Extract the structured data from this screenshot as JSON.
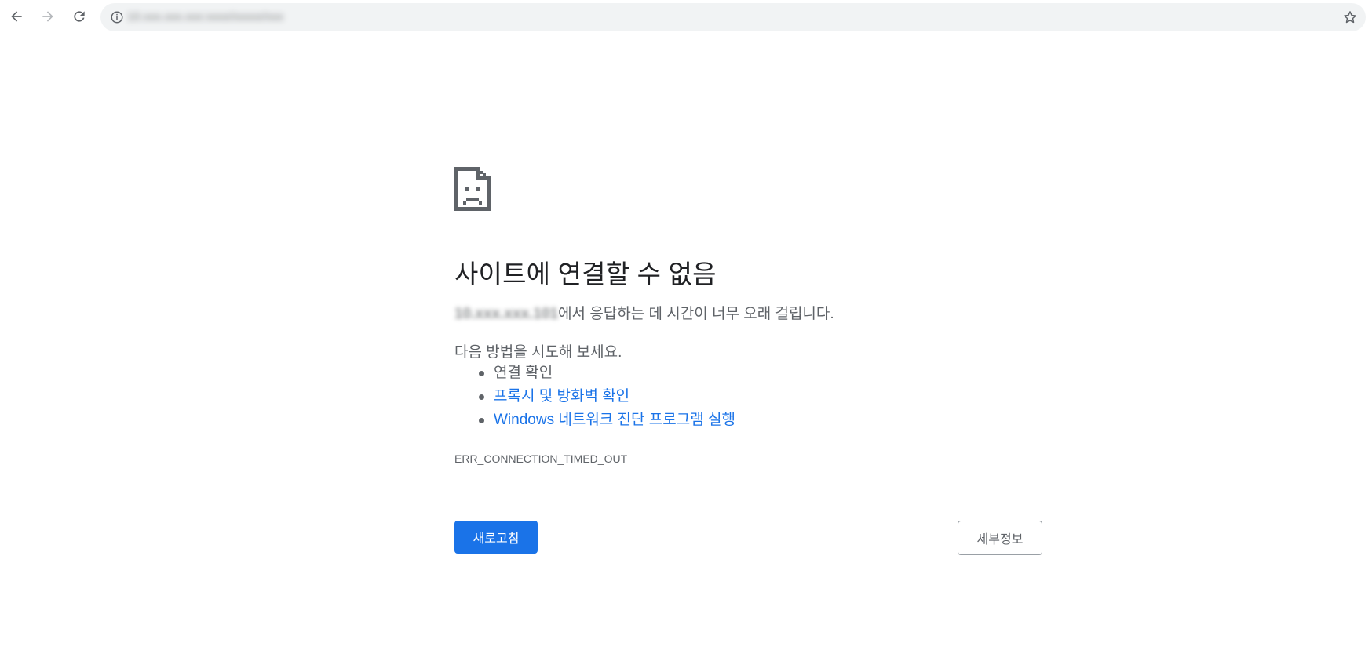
{
  "browser": {
    "url": "10.xxx.xxx.xxx:xxxx/xxxxx/xxx",
    "icons": {
      "back": "arrow-left-icon",
      "forward": "arrow-right-icon",
      "reload": "reload-icon",
      "site_info": "info-icon",
      "bookmark": "star-icon"
    }
  },
  "error_page": {
    "icon": "sad-document-icon",
    "title": "사이트에 연결할 수 없음",
    "host": "10.xxx.xxx.101",
    "description_suffix": "에서 응답하는 데 시간이 너무 오래 걸립니다.",
    "try_heading": "다음 방법을 시도해 보세요.",
    "suggestions": [
      "연결 확인",
      "프록시 및 방화벽 확인",
      "Windows 네트워크 진단 프로그램 실행"
    ],
    "error_code": "ERR_CONNECTION_TIMED_OUT",
    "reload_button": "새로고침",
    "details_button": "세부정보"
  },
  "colors": {
    "primary_blue": "#1a73e8",
    "text_dark": "#202124",
    "text_gray": "#5f6368",
    "omnibox_bg": "#f1f3f4"
  }
}
